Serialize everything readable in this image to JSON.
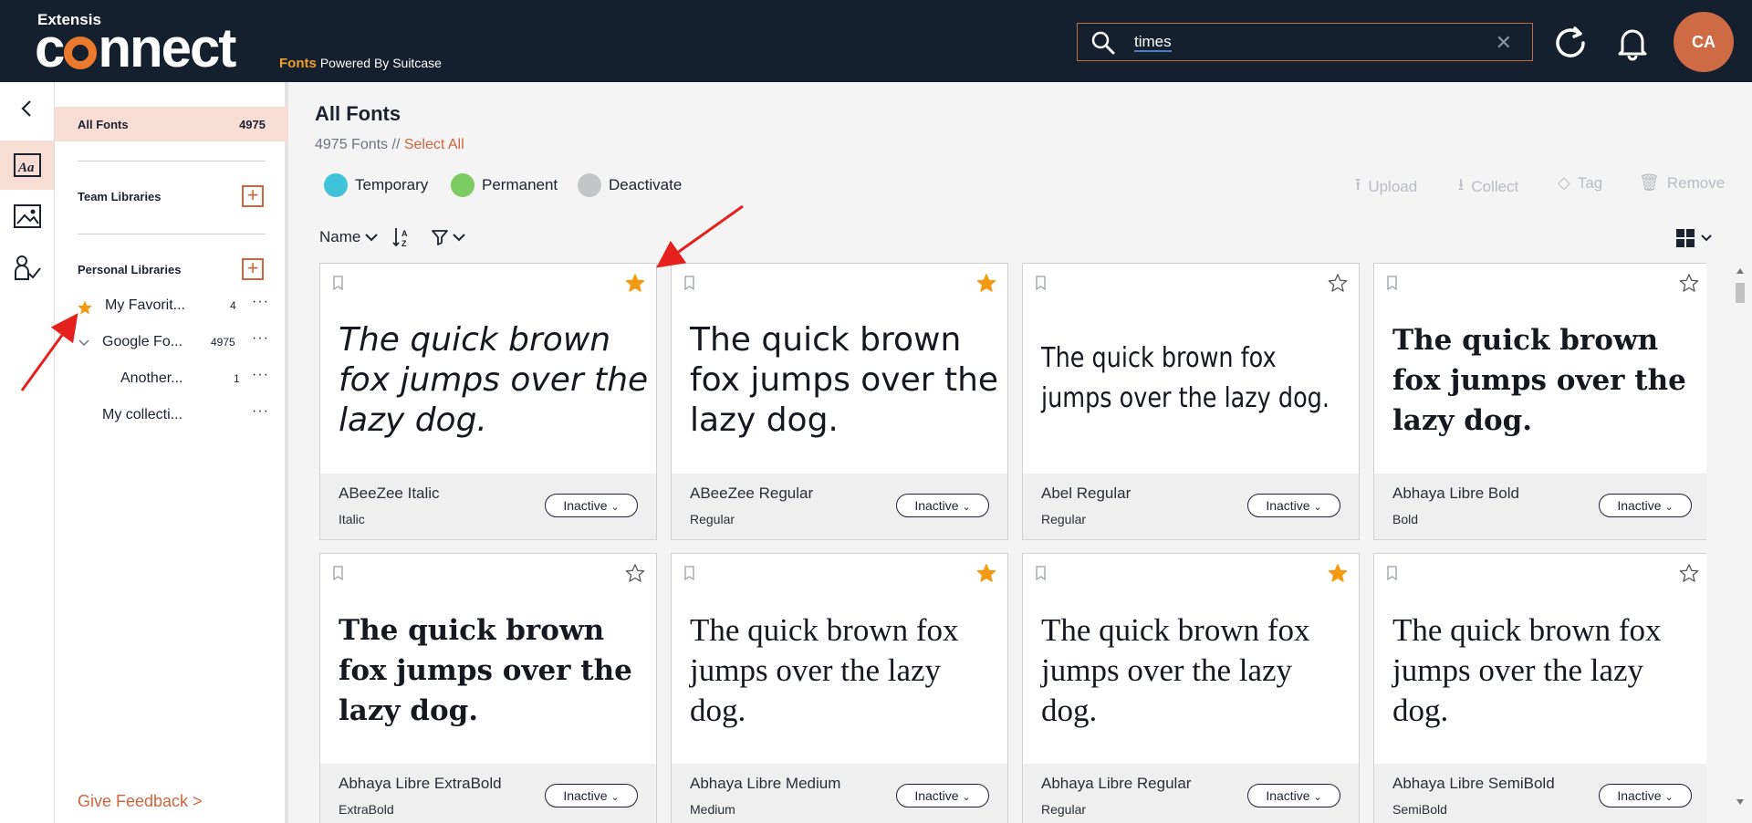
{
  "header": {
    "brand_small": "Extensis",
    "brand_big_prefix": "c",
    "brand_big_suffix": "nnect",
    "product": "Fonts",
    "powered_by": "Powered By Suitcase",
    "search_value": "times",
    "search_clear": "✕",
    "avatar_initials": "CA"
  },
  "sidebar": {
    "all_fonts_label": "All Fonts",
    "all_fonts_count": "4975",
    "team_libraries": "Team Libraries",
    "personal_libraries": "Personal Libraries",
    "items": [
      {
        "name": "My Favorit...",
        "count": "4",
        "more": "···"
      },
      {
        "name": "Google Fo...",
        "count": "4975",
        "more": "···"
      },
      {
        "name": "Another...",
        "count": "1",
        "more": "···"
      },
      {
        "name": "My collecti...",
        "count": "",
        "more": "···"
      }
    ],
    "feedback": "Give Feedback >"
  },
  "main": {
    "title": "All Fonts",
    "count_text": "4975 Fonts //",
    "select_all": "Select All",
    "legend": [
      {
        "label": "Temporary",
        "color": "#3fc3d8"
      },
      {
        "label": "Permanent",
        "color": "#7ccb63"
      },
      {
        "label": "Deactivate",
        "color": "#c4c5c7"
      }
    ],
    "actions": [
      "Upload",
      "Collect",
      "Tag",
      "Remove"
    ],
    "sort_label": "Name"
  },
  "cards": [
    {
      "sample": "The quick brown fox jumps over the lazy dog.",
      "name": "ABeeZee Italic",
      "style": "Italic",
      "status": "Inactive",
      "favorite": true
    },
    {
      "sample": "The quick brown fox jumps over the lazy dog.",
      "name": "ABeeZee Regular",
      "style": "Regular",
      "status": "Inactive",
      "favorite": true
    },
    {
      "sample": "The quick brown fox jumps over the lazy dog.",
      "name": "Abel Regular",
      "style": "Regular",
      "status": "Inactive",
      "favorite": false
    },
    {
      "sample": "The quick brown fox jumps over the lazy dog.",
      "name": "Abhaya Libre Bold",
      "style": "Bold",
      "status": "Inactive",
      "favorite": false
    },
    {
      "sample": "The quick brown fox jumps over the lazy dog.",
      "name": "Abhaya Libre ExtraBold",
      "style": "ExtraBold",
      "status": "Inactive",
      "favorite": false
    },
    {
      "sample": "The quick brown fox jumps over the lazy dog.",
      "name": "Abhaya Libre Medium",
      "style": "Medium",
      "status": "Inactive",
      "favorite": true
    },
    {
      "sample": "The quick brown fox jumps over the lazy dog.",
      "name": "Abhaya Libre Regular",
      "style": "Regular",
      "status": "Inactive",
      "favorite": true
    },
    {
      "sample": "The quick brown fox jumps over the lazy dog.",
      "name": "Abhaya Libre SemiBold",
      "style": "SemiBold",
      "status": "Inactive",
      "favorite": false
    }
  ],
  "colors": {
    "accent": "#d0643c",
    "star": "#f29a12",
    "header_bg": "#15202f"
  }
}
